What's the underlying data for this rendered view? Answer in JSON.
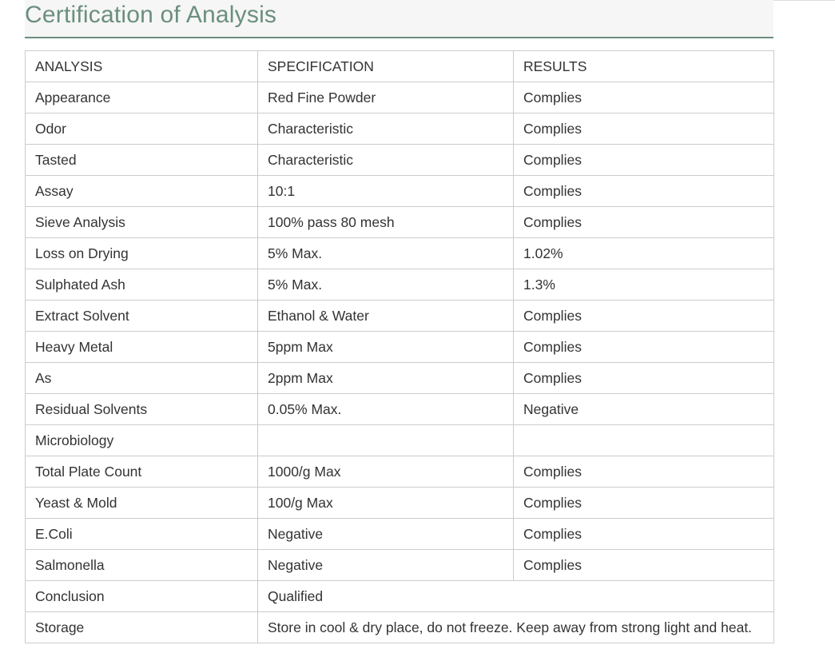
{
  "title": "Certification of Analysis",
  "headers": [
    "ANALYSIS",
    "SPECIFICATION",
    "RESULTS"
  ],
  "rows": [
    {
      "analysis": "Appearance",
      "specification": "Red Fine Powder",
      "results": "Complies"
    },
    {
      "analysis": "Odor",
      "specification": "Characteristic",
      "results": "Complies"
    },
    {
      "analysis": "Tasted",
      "specification": "Characteristic",
      "results": "Complies"
    },
    {
      "analysis": "Assay",
      "specification": "10:1",
      "results": "Complies"
    },
    {
      "analysis": "Sieve Analysis",
      "specification": "100% pass 80 mesh",
      "results": "Complies"
    },
    {
      "analysis": "Loss on Drying",
      "specification": "5% Max.",
      "results": "1.02%"
    },
    {
      "analysis": "Sulphated Ash",
      "specification": "5% Max.",
      "results": "1.3%"
    },
    {
      "analysis": "Extract Solvent",
      "specification": "Ethanol & Water",
      "results": "Complies"
    },
    {
      "analysis": "Heavy Metal",
      "specification": "5ppm Max",
      "results": "Complies"
    },
    {
      "analysis": "As",
      "specification": "2ppm Max",
      "results": "Complies"
    },
    {
      "analysis": "Residual Solvents",
      "specification": "0.05% Max.",
      "results": "Negative"
    },
    {
      "analysis": "Microbiology",
      "specification": "",
      "results": ""
    },
    {
      "analysis": "Total Plate Count",
      "specification": "1000/g Max",
      "results": "Complies"
    },
    {
      "analysis": "Yeast & Mold",
      "specification": "100/g Max",
      "results": "Complies"
    },
    {
      "analysis": "E.Coli",
      "specification": "Negative",
      "results": "Complies"
    },
    {
      "analysis": "Salmonella",
      "specification": "Negative",
      "results": "Complies"
    }
  ],
  "merged_rows": [
    {
      "analysis": "Conclusion",
      "value": "Qualified"
    },
    {
      "analysis": "Storage",
      "value": "Store in cool & dry place, do not freeze. Keep away from strong light and heat."
    }
  ],
  "colors": {
    "title": "#6b8f7f",
    "title_bg": "#f6f6f6",
    "border": "#cccccc",
    "text": "#333333"
  }
}
